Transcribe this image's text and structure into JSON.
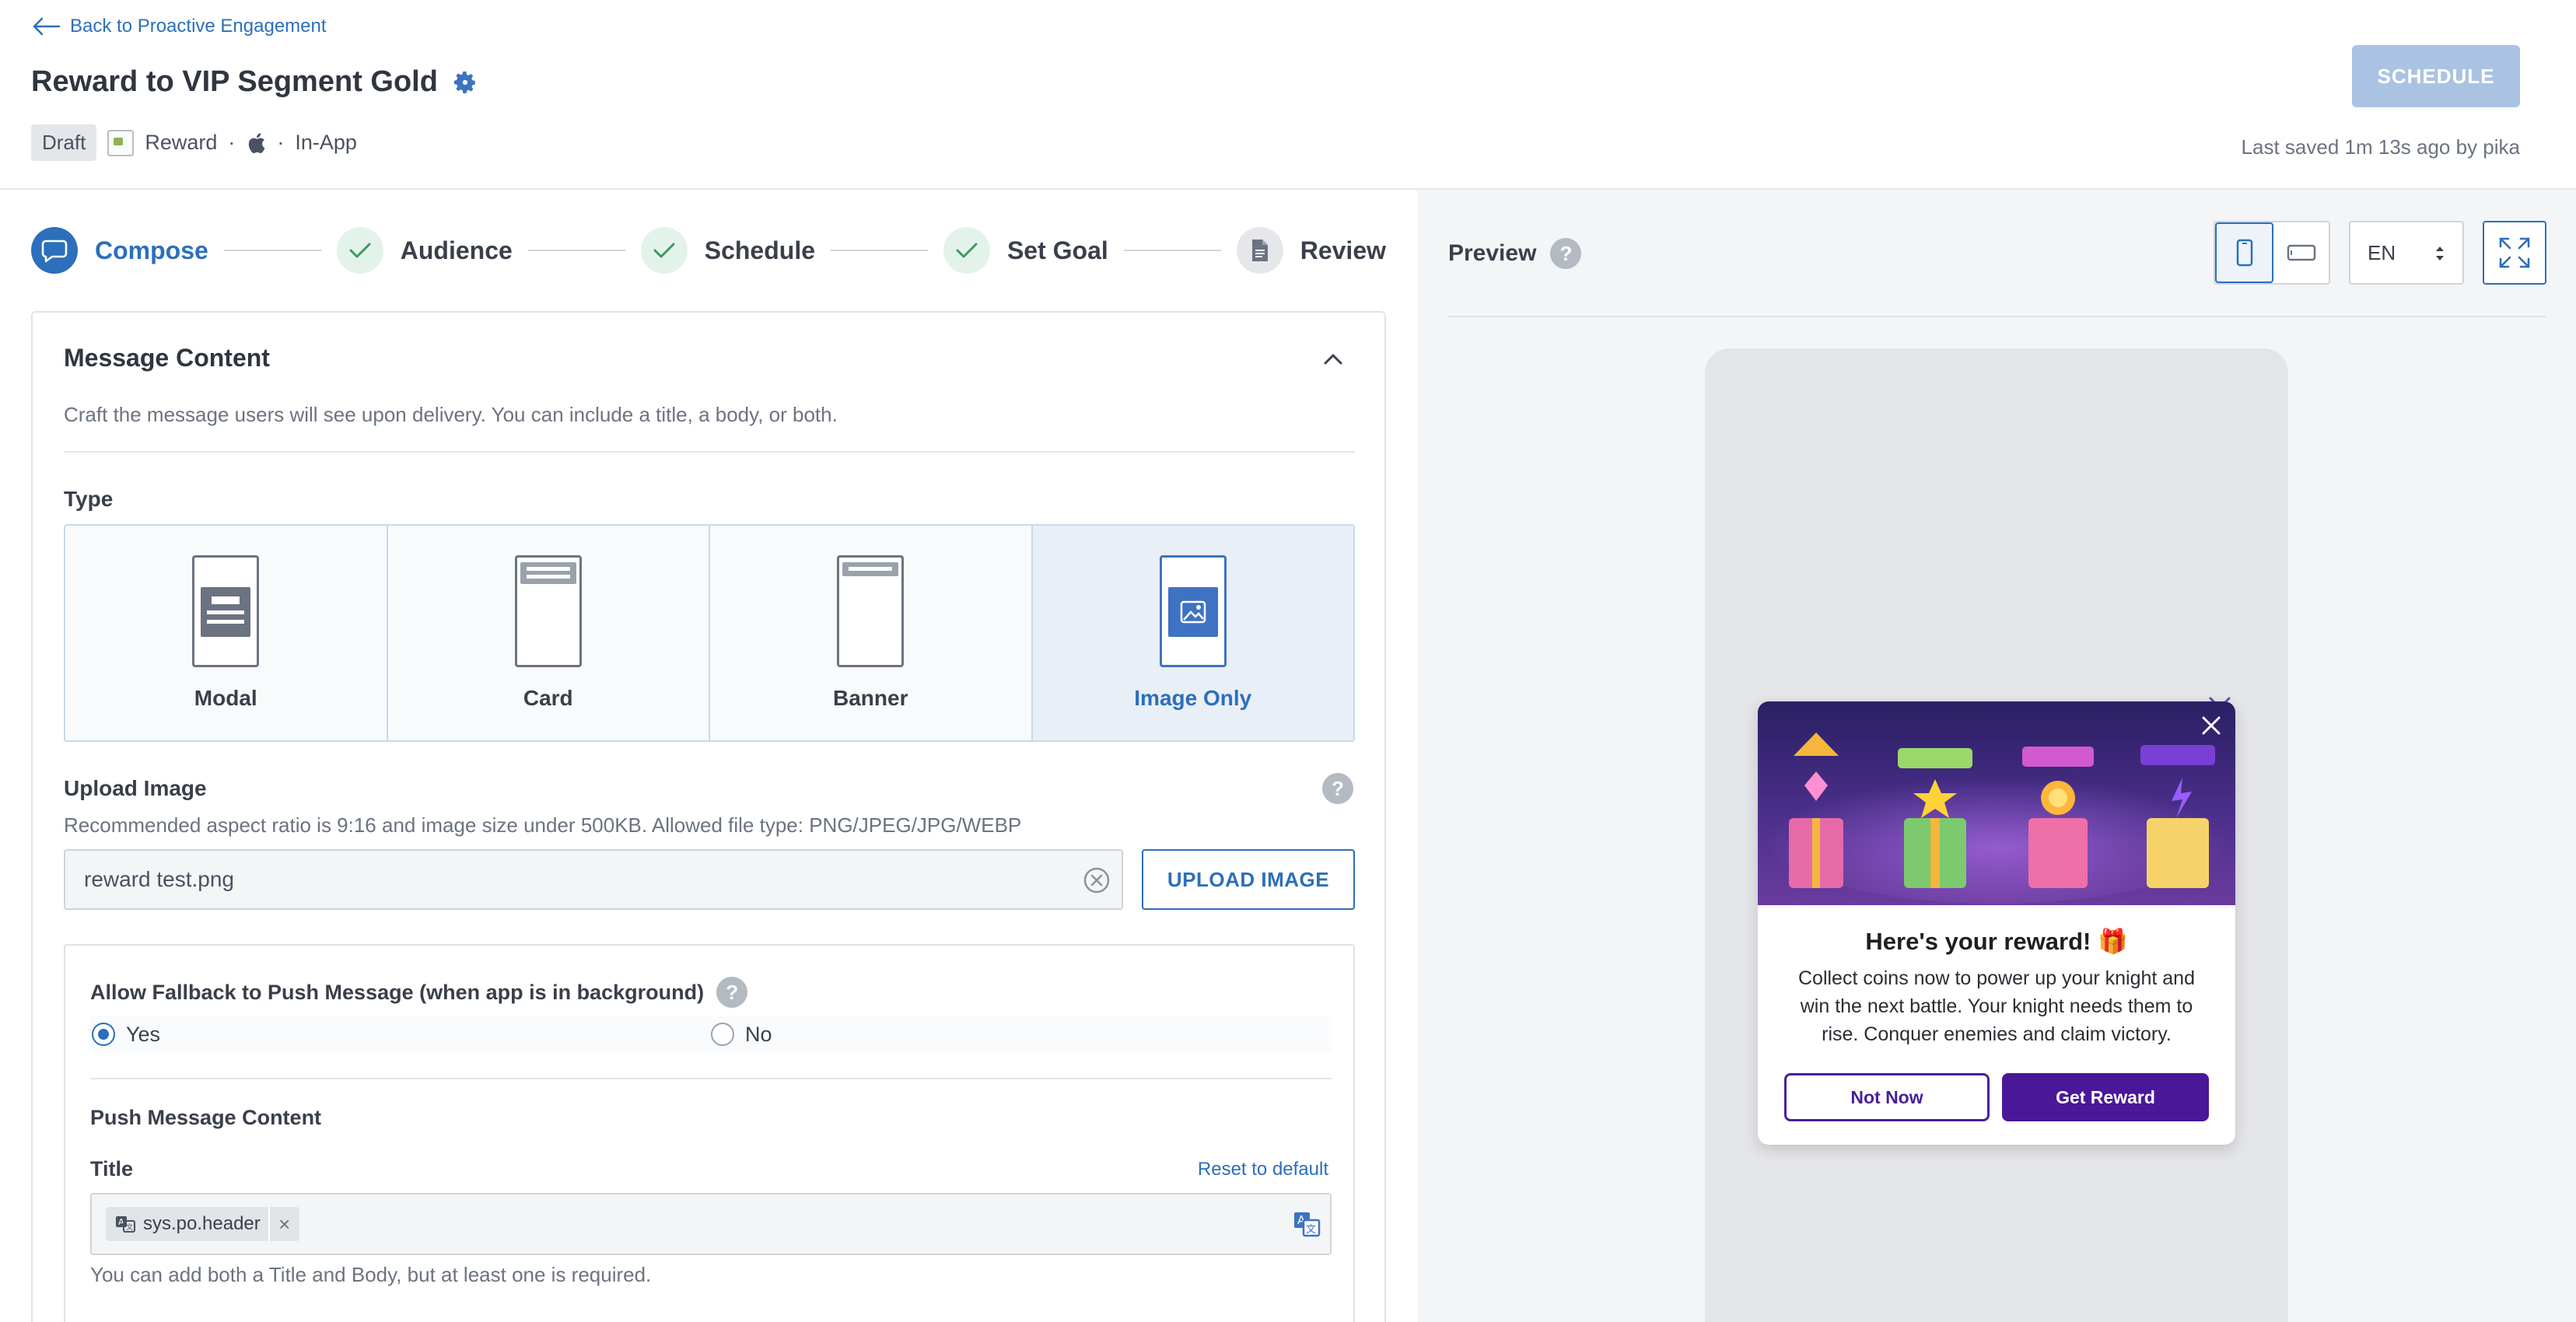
{
  "header": {
    "back_link": "Back to Proactive Engagement",
    "title": "Reward to VIP Segment Gold",
    "status_badge": "Draft",
    "campaign_type": "Reward",
    "separator": "·",
    "channel": "In-App",
    "schedule_button": "SCHEDULE",
    "last_saved": "Last saved 1m 13s ago by pika"
  },
  "stepper": {
    "steps": [
      {
        "label": "Compose",
        "state": "active"
      },
      {
        "label": "Audience",
        "state": "done"
      },
      {
        "label": "Schedule",
        "state": "done"
      },
      {
        "label": "Set Goal",
        "state": "done"
      },
      {
        "label": "Review",
        "state": "todo"
      }
    ]
  },
  "message_content": {
    "title": "Message Content",
    "description": "Craft the message users will see upon delivery. You can include a title, a body, or both.",
    "type_label": "Type",
    "types": [
      "Modal",
      "Card",
      "Banner",
      "Image Only"
    ],
    "selected_type": "Image Only",
    "upload": {
      "label": "Upload Image",
      "help_icon": "?",
      "description": "Recommended aspect ratio is 9:16 and image size under 500KB. Allowed file type: PNG/JPEG/JPG/WEBP",
      "file_name": "reward test.png",
      "button": "UPLOAD IMAGE"
    },
    "fallback": {
      "label": "Allow Fallback to Push Message (when app is in background)",
      "help_icon": "?",
      "options": [
        "Yes",
        "No"
      ],
      "selected": "Yes",
      "push_content_label": "Push Message Content",
      "title_label": "Title",
      "reset_link": "Reset to default",
      "title_chip": "sys.po.header",
      "chip_remove": "×",
      "title_help": "You can add both a Title and Body, but at least one is required."
    }
  },
  "preview": {
    "title": "Preview",
    "help_icon": "?",
    "language": "EN",
    "modal": {
      "heading": "Here's your reward! 🎁",
      "body": "Collect coins now to power up your knight and win the next battle. Your knight needs them to rise. Conquer enemies and claim victory.",
      "secondary_button": "Not Now",
      "primary_button": "Get Reward"
    }
  },
  "colors": {
    "accent": "#2c6fbb",
    "schedule_disabled": "#aac3e3",
    "modal_primary": "#4a1798",
    "success_bg": "#e3f3ea",
    "success_check": "#3a9a64"
  }
}
